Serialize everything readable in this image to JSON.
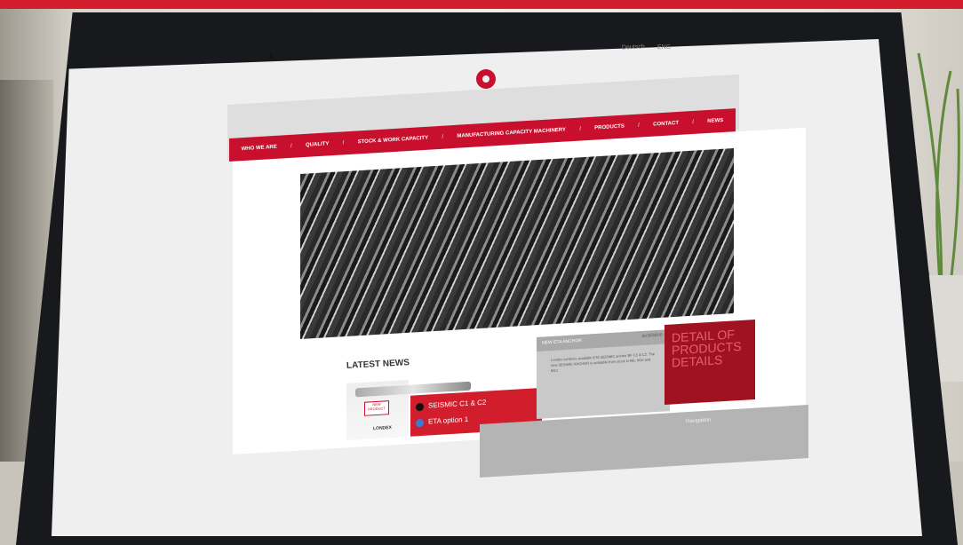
{
  "site": {
    "logo_text": "LONDEX",
    "lang_links": [
      "Deutsch",
      "ENG"
    ],
    "nav": [
      {
        "label": "WHO WE ARE"
      },
      {
        "label": "QUALITY"
      },
      {
        "label": "STOCK & WORK CAPACITY"
      },
      {
        "label": "MANUFACTURING CAPACITY MACHINERY"
      },
      {
        "label": "PRODUCTS"
      },
      {
        "label": "CONTACT"
      },
      {
        "label": "NEWS"
      }
    ],
    "news": {
      "heading": "LATEST NEWS",
      "item_line1": "SEISMIC C1 & C2",
      "item_line2": "ETA option 1",
      "badge_text": "NEW PRODUCT",
      "card_logo": "LONDEX"
    },
    "promo_box": {
      "header": "NEW ETA ANCHOR",
      "header_tag": "available",
      "body": "Londex confirms available ETA SEISMIC anchor BF C1 & C2. The new SEISMIC ANCHOR is available from stock in M8, M10 and M12."
    },
    "red_box_text": "DETAIL OF PRODUCTS DETAILS",
    "footer_label": "Navigation"
  },
  "colors": {
    "brand_red": "#c8102e",
    "dark_red": "#a11220",
    "bezel": "#17191c"
  }
}
